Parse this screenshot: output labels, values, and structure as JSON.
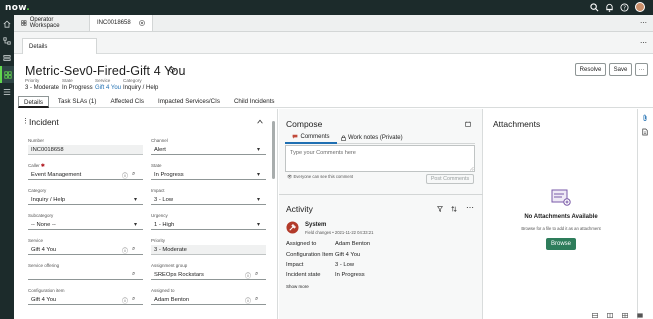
{
  "app": {
    "logo_text": "now",
    "logo_dot": "."
  },
  "top_icons": [
    "search-icon",
    "bell-icon",
    "help-icon",
    "avatar"
  ],
  "workspace_tabs": [
    {
      "label": "Operator Workspace",
      "icon": "grid-icon"
    },
    {
      "label": "INC0018658",
      "icon": "close-icon"
    }
  ],
  "subtab": {
    "label": "Details"
  },
  "record": {
    "title": "Metric-Sev0-Fired-Gift 4 You",
    "meta": [
      {
        "label": "Priority",
        "value": "3 - Moderate"
      },
      {
        "label": "State",
        "value": "In Progress"
      },
      {
        "label": "Service",
        "value": "Gift 4 You"
      },
      {
        "label": "Category",
        "value": "Inquiry / Help"
      }
    ],
    "actions": {
      "resolve": "Resolve",
      "save": "Save",
      "more": "···"
    }
  },
  "record_tabs": [
    "Details",
    "Task SLAs (1)",
    "Affected CIs",
    "Impacted Services/CIs",
    "Child Incidents"
  ],
  "incident": {
    "title": "Incident",
    "fields": {
      "number": {
        "label": "Number",
        "value": "INC0018658"
      },
      "caller": {
        "label": "Caller",
        "value": "Event Management"
      },
      "category": {
        "label": "Category",
        "value": "Inquiry / Help"
      },
      "subcategory": {
        "label": "Subcategory",
        "value": "-- None --"
      },
      "service": {
        "label": "Service",
        "value": "Gift 4 You"
      },
      "service_offering": {
        "label": "Service offering",
        "value": ""
      },
      "configuration_item": {
        "label": "Configuration item",
        "value": "Gift 4 You"
      },
      "channel": {
        "label": "Channel",
        "value": "Alert"
      },
      "state": {
        "label": "State",
        "value": "In Progress"
      },
      "impact": {
        "label": "Impact",
        "value": "3 - Low"
      },
      "urgency": {
        "label": "Urgency",
        "value": "1 - High"
      },
      "priority": {
        "label": "Priority",
        "value": "3 - Moderate"
      },
      "assignment_group": {
        "label": "Assignment group",
        "value": "SREOps Rockstars"
      },
      "assigned_to": {
        "label": "Assigned to",
        "value": "Adam Benton"
      }
    }
  },
  "compose": {
    "title": "Compose",
    "tabs": [
      {
        "label": "Comments",
        "icon": "comments-icon"
      },
      {
        "label": "Work notes (Private)",
        "icon": "lock-icon"
      }
    ],
    "placeholder": "Type your Comments here",
    "visibility_note": "Everyone can see this comment",
    "post_button": "Post Comments"
  },
  "activity": {
    "title": "Activity",
    "entry": {
      "author": "System",
      "subtitle": "Field changes • 2021-11-22 04:33:21",
      "changes": [
        {
          "field": "Assigned to",
          "value": "Adam Benton"
        },
        {
          "field": "Configuration Item",
          "value": "Gift 4 You"
        },
        {
          "field": "Impact",
          "value": "3 - Low"
        },
        {
          "field": "Incident state",
          "value": "In Progress"
        }
      ],
      "show_more": "Show more"
    }
  },
  "attachments": {
    "title": "Attachments",
    "empty_title": "No Attachments Available",
    "empty_sub": "Browse for a file to add it as an attachment",
    "browse": "Browse"
  },
  "colors": {
    "topbar": "#1c2b2b",
    "accent_green": "#62d84e",
    "browse_green": "#2e7d5b",
    "link_blue": "#1f6fb2"
  }
}
